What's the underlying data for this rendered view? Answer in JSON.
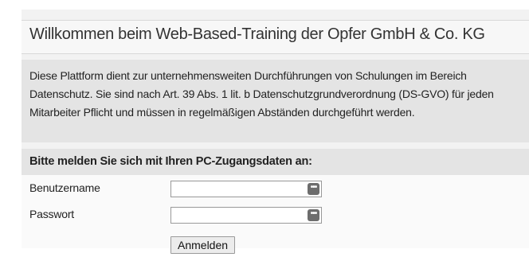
{
  "page": {
    "title": "Willkommen beim Web-Based-Training der Opfer GmbH & Co. KG",
    "info": "Diese Plattform dient zur unternehmensweiten Durchführungen von Schulungen im Bereich Datenschutz. Sie sind nach Art. 39 Abs. 1 lit. b Datenschutzgrundverordnung (DS-GVO) für jeden Mitarbeiter Pflicht und müssen in regelmäßigen Abständen durchgeführt werden."
  },
  "login": {
    "header": "Bitte melden Sie sich mit Ihren PC-Zugangsdaten an:",
    "username_label": "Benutzername",
    "username_value": "",
    "password_label": "Passwort",
    "password_value": "",
    "field_button_glyph": "•••",
    "submit_label": "Anmelden"
  }
}
